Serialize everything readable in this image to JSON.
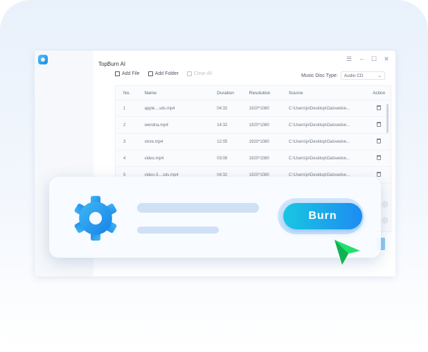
{
  "app": {
    "title": "TopBurn AI"
  },
  "window_controls": {
    "menu": "☰",
    "minimize": "–",
    "maximize": "☐",
    "close": "✕"
  },
  "toolbar": {
    "add_file": "Add File",
    "add_folder": "Add Folder",
    "clear_all": "Clear All"
  },
  "disc_type": {
    "label": "Music Disc Type:",
    "selected": "Audio CD",
    "arrow": "⌄"
  },
  "table": {
    "columns": [
      "No.",
      "Name",
      "Duration",
      "Resolution",
      "Source",
      "Action"
    ],
    "rows": [
      {
        "no": "1",
        "name": "apple....sds.mp4",
        "duration": "04:32",
        "resolution": "1920*1080",
        "source": "C:\\Users\\jx\\Desktop\\Oalsvedve..."
      },
      {
        "no": "2",
        "name": "wendna.mp4",
        "duration": "14:32",
        "resolution": "1920*1080",
        "source": "C:\\Users\\jx\\Desktop\\Oalsvedve..."
      },
      {
        "no": "3",
        "name": "store.mp4",
        "duration": "12:05",
        "resolution": "1920*1080",
        "source": "C:\\Users\\jx\\Desktop\\Oalsvedve..."
      },
      {
        "no": "4",
        "name": "video.mp4",
        "duration": "03:08",
        "resolution": "1920*1080",
        "source": "C:\\Users\\jx\\Desktop\\Oalsvedve..."
      },
      {
        "no": "5",
        "name": "video-3....sds.mp4",
        "duration": "04:32",
        "resolution": "1920*1080",
        "source": "C:\\Users\\jx\\Desktop\\Oalsvedve..."
      }
    ]
  },
  "overlay": {
    "burn_label": "Burn"
  },
  "colors": {
    "accent_start": "#19c6e2",
    "accent_end": "#1d8cf2",
    "gear": "#1e9bf0",
    "cursor": "#22e06a"
  }
}
